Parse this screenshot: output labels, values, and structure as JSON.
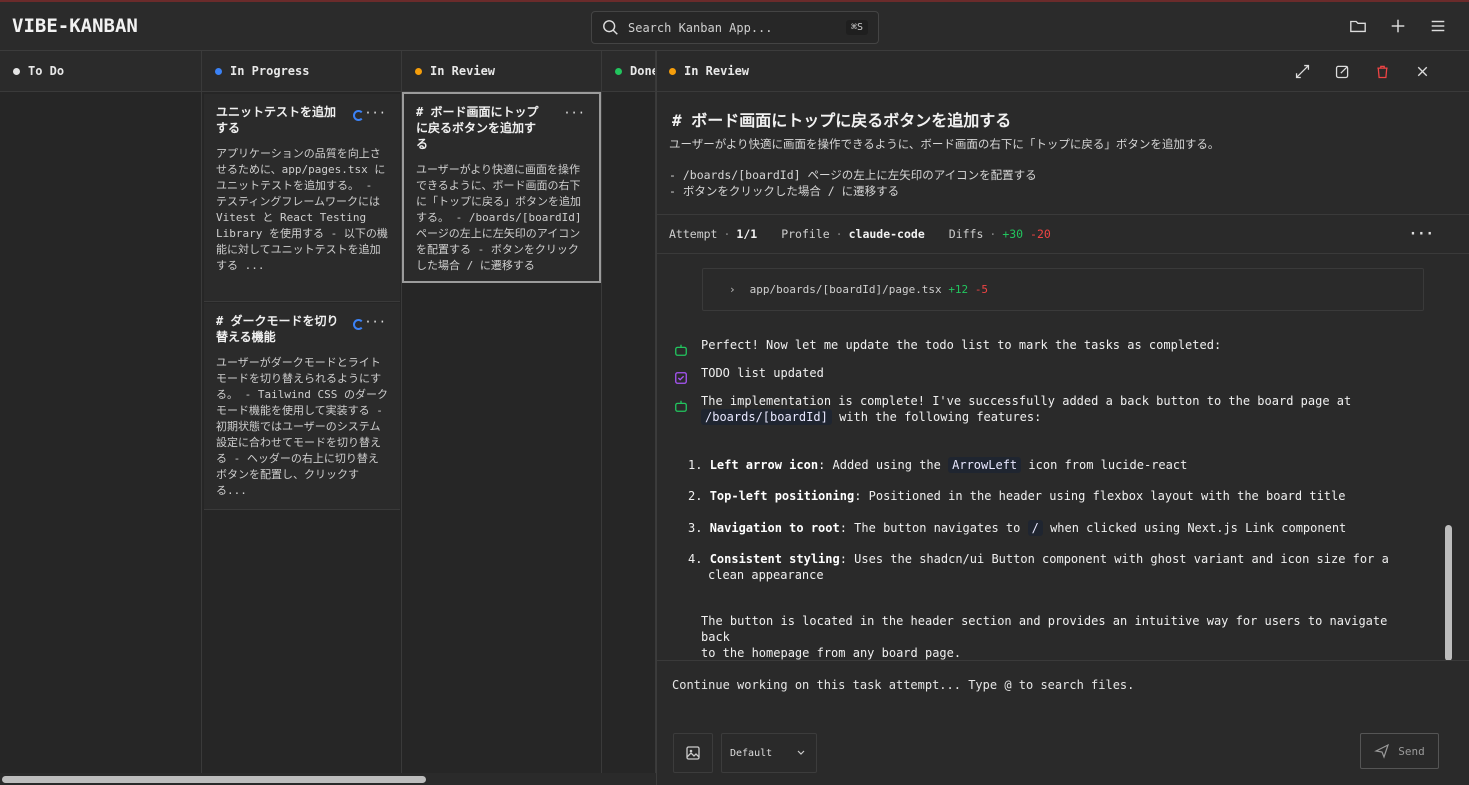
{
  "app": {
    "logo": "VIBE-KANBAN"
  },
  "search": {
    "placeholder": "Search Kanban App...",
    "shortcut": "⌘S"
  },
  "header_icons": [
    "folder-icon",
    "plus-icon",
    "menu-icon"
  ],
  "columns": [
    {
      "label": "To Do",
      "color": "#e5e5e5"
    },
    {
      "label": "In Progress",
      "color": "#3b82f6"
    },
    {
      "label": "In Review",
      "color": "#f59e0b"
    },
    {
      "label": "Done",
      "color": "#22c55e"
    }
  ],
  "cards": [
    {
      "title": "ユニットテストを追加する",
      "desc": "アプリケーションの品質を向上させるために、app/pages.tsx にユニットテストを追加する。 - テスティングフレームワークには Vitest と React Testing Library を使用する - 以下の機能に対してユニットテストを追加する ..."
    },
    {
      "title": "# ダークモードを切り替える機能",
      "desc": "ユーザーがダークモードとライトモードを切り替えられるようにする。 - Tailwind CSS のダークモード機能を使用して実装する - 初期状態ではユーザーのシステム設定に合わせてモードを切り替える - ヘッダーの右上に切り替えボタンを配置し、クリックする..."
    },
    {
      "title": "# ボード画面にトップに戻るボタンを追加する",
      "desc": "ユーザーがより快適に画面を操作できるように、ボード画面の右下に「トップに戻る」ボタンを追加する。 - /boards/[boardId] ページの左上に左矢印のアイコンを配置する - ボタンをクリックした場合 / に遷移する"
    }
  ],
  "panel": {
    "status": "In Review",
    "status_color": "#f59e0b",
    "title": "# ボード画面にトップに戻るボタンを追加する",
    "desc_line1": "ユーザーがより快適に画面を操作できるように、ボード画面の右下に「トップに戻る」ボタンを追加する。",
    "desc_line2": "- /boards/[boardId] ページの左上に左矢印のアイコンを配置する",
    "desc_line3": "- ボタンをクリックした場合 / に遷移する",
    "attempt_label": "Attempt",
    "attempt_value": "1/1",
    "profile_label": "Profile",
    "profile_value": "claude-code",
    "diffs_label": "Diffs",
    "diffs_add": "+30",
    "diffs_del": "-20"
  },
  "file": {
    "path": "app/boards/[boardId]/page.tsx",
    "add": "+12",
    "del": "-5"
  },
  "messages": {
    "m1": "Perfect! Now let me update the todo list to mark the tasks as completed:",
    "m2": "TODO list updated",
    "m3a": "The implementation is complete! I've successfully added a back button to the board page at",
    "m3_code": "/boards/[boardId]",
    "m3b": "with the following features:",
    "li1_num": "1.",
    "li1_bold": "Left arrow icon",
    "li1_a": ": Added using the",
    "li1_code": "ArrowLeft",
    "li1_b": "icon from lucide-react",
    "li2_num": "2.",
    "li2_bold": "Top-left positioning",
    "li2_a": ": Positioned in the header using flexbox layout with the board title",
    "li3_num": "3.",
    "li3_bold": "Navigation to root",
    "li3_a": ": The button navigates to",
    "li3_code": "/",
    "li3_b": "when clicked using Next.js Link component",
    "li4_num": "4.",
    "li4_bold": "Consistent styling",
    "li4_a": ": Uses the shadcn/ui Button component with ghost variant and icon size for a",
    "li4_b": "clean appearance",
    "final1": "The button is located in the header section and provides an intuitive way for users to navigate back",
    "final2": "to the homepage from any board page."
  },
  "composer": {
    "placeholder": "Continue working on this task attempt... Type @ to search files.",
    "select_value": "Default",
    "send_label": "Send"
  }
}
